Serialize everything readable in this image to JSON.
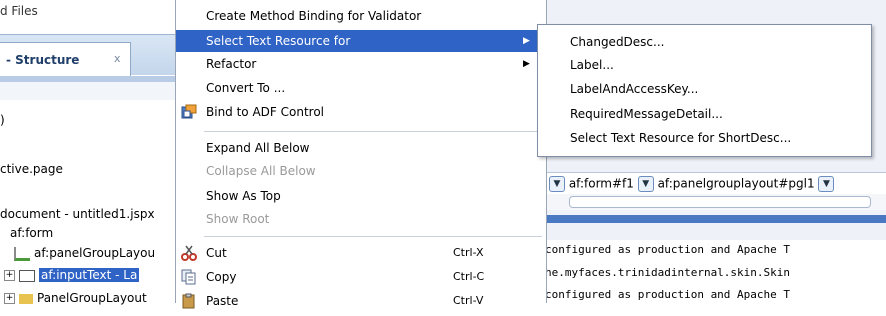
{
  "left_panel": {
    "files_label": "d Files",
    "structure_tab": "- Structure",
    "tab_close": "x",
    "paren": ")",
    "page_label": "ctive.page",
    "document_label": "document - untitled1.jspx",
    "tree": [
      "af:form",
      "af:panelGroupLayou",
      "af:inputText - La",
      "PanelGroupLayout"
    ]
  },
  "menu": {
    "items": [
      {
        "label": "Create Method Binding for Validator"
      },
      {
        "label": "Select Text Resource for",
        "submenu": true
      },
      {
        "label": "Refactor",
        "submenu": true
      },
      {
        "label": "Convert To ..."
      },
      {
        "label": "Bind to ADF Control"
      },
      {
        "label": "Expand All Below"
      },
      {
        "label": "Collapse All Below"
      },
      {
        "label": "Show As Top"
      },
      {
        "label": "Show Root"
      },
      {
        "label": "Cut",
        "shortcut": "Ctrl-X"
      },
      {
        "label": "Copy",
        "shortcut": "Ctrl-C"
      },
      {
        "label": "Paste",
        "shortcut": "Ctrl-V"
      }
    ]
  },
  "submenu": {
    "items": [
      "ChangedDesc...",
      "Label...",
      "LabelAndAccessKey...",
      "RequiredMessageDetail...",
      "Select Text Resource for ShortDesc..."
    ]
  },
  "breadcrumb": {
    "items": [
      "af:form#f1",
      "af:panelgrouplayout#pgl1"
    ]
  },
  "console": {
    "lines": [
      "configured as production and Apache T",
      "he.myfaces.trinidadinternal.skin.Skin",
      "configured as production and Apache T"
    ]
  },
  "colors": {
    "selection": "#2f63c6",
    "accent": "#4a79c4"
  }
}
